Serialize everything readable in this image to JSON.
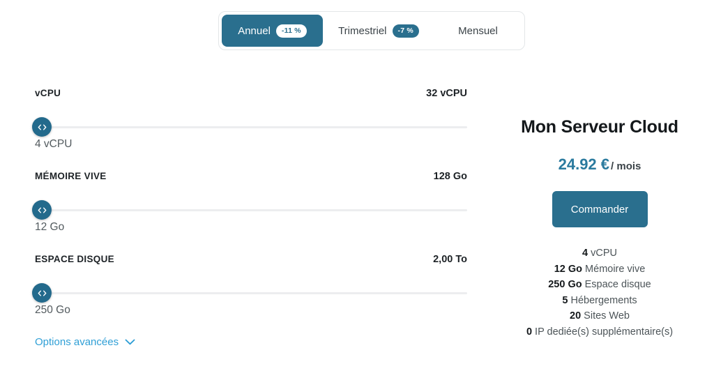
{
  "billing_tabs": {
    "name": "billing-period-selector",
    "items": [
      {
        "label": "Annuel",
        "badge": "-11 %",
        "active": true
      },
      {
        "label": "Trimestriel",
        "badge": "-7 %",
        "active": false
      },
      {
        "label": "Mensuel",
        "badge": "",
        "active": false
      }
    ]
  },
  "sliders": [
    {
      "label": "vCPU",
      "max_label": "32 vCPU",
      "value_label": "4 vCPU",
      "handle_icon": "resize-horizontal-icon"
    },
    {
      "label": "MÉMOIRE VIVE",
      "max_label": "128 Go",
      "value_label": "12 Go",
      "handle_icon": "resize-horizontal-icon"
    },
    {
      "label": "ESPACE DISQUE",
      "max_label": "2,00 To",
      "value_label": "250 Go",
      "handle_icon": "resize-horizontal-icon"
    }
  ],
  "advanced_options": {
    "label": "Options avancées",
    "icon": "chevron-down-icon"
  },
  "summary": {
    "title": "Mon Serveur Cloud",
    "price": "24.92 €",
    "period": "/ mois",
    "order_label": "Commander",
    "specs": [
      {
        "amount": "4",
        "text": "vCPU"
      },
      {
        "amount": "12 Go",
        "text": "Mémoire vive"
      },
      {
        "amount": "250 Go",
        "text": "Espace disque"
      },
      {
        "amount": "5",
        "text": "Hébergements"
      },
      {
        "amount": "20",
        "text": "Sites Web"
      },
      {
        "amount": "0",
        "text": "IP dediée(s) supplémentaire(s)"
      }
    ]
  },
  "colors": {
    "accent": "#2a6f8e",
    "handle": "#236a8c",
    "price": "#2a7a9e",
    "link": "#2f9fd6",
    "track": "#ecedef",
    "border": "#e3e6e8"
  }
}
